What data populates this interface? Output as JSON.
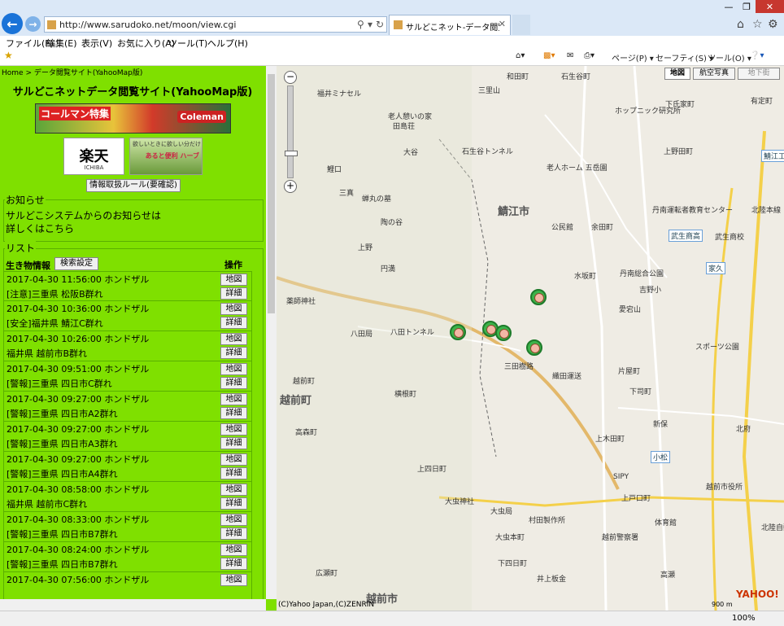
{
  "browser": {
    "url": "http://www.sarudoko.net/moon/view.cgi",
    "tab_title": "サルどこネット-データ閲覧サイ...",
    "menu": [
      "ファイル(F)",
      "編集(E)",
      "表示(V)",
      "お気に入り(A)",
      "ツール(T)",
      "ヘルプ(H)"
    ],
    "commands": [
      "ページ(P) ▾",
      "セーフティ(S) ▾",
      "ツール(O) ▾"
    ],
    "zoom": "100%",
    "colors": {
      "accent": "#1a73d8",
      "panel": "#7fe000"
    }
  },
  "left": {
    "breadcrumb": "Home > データ閲覧サイト(YahooMap版)",
    "title": "サルどこネットデータ閲覧サイト(YahooMap版)",
    "ad_coleman_text": "コールマン特集",
    "ad_coleman_brand": "Coleman",
    "ad_rakuten": "楽天",
    "ad_rakuten_sub": "ICHIBA",
    "ad_herb_text": "欲しいときに欲しい分だけ",
    "ad_herb_title": "あると便利 ハーブ",
    "rules_button": "情報取扱ルール(要確認)",
    "notice_legend": "お知らせ",
    "notice_text": [
      "サルどこシステムからのお知らせは",
      "詳しくはこちら"
    ],
    "list_legend": "リスト",
    "list_header": "生き物情報",
    "search_button": "検索設定",
    "ops_header": "操作",
    "map_button": "地図",
    "detail_button": "詳細",
    "rows": [
      {
        "l1": "2017-04-30 11:56:00 ホンドザル",
        "l2": "[注意]三重県 松阪B群れ"
      },
      {
        "l1": "2017-04-30 10:36:00 ホンドザル",
        "l2": "[安全]福井県 鯖江C群れ"
      },
      {
        "l1": "2017-04-30 10:26:00 ホンドザル",
        "l2": "福井県 越前市B群れ"
      },
      {
        "l1": "2017-04-30 09:51:00 ホンドザル",
        "l2": "[警報]三重県 四日市C群れ"
      },
      {
        "l1": "2017-04-30 09:27:00 ホンドザル",
        "l2": "[警報]三重県 四日市A2群れ"
      },
      {
        "l1": "2017-04-30 09:27:00 ホンドザル",
        "l2": "[警報]三重県 四日市A3群れ"
      },
      {
        "l1": "2017-04-30 09:27:00 ホンドザル",
        "l2": "[警報]三重県 四日市A4群れ"
      },
      {
        "l1": "2017-04-30 08:58:00 ホンドザル",
        "l2": "福井県 越前市C群れ"
      },
      {
        "l1": "2017-04-30 08:33:00 ホンドザル",
        "l2": "[警報]三重県 四日市B7群れ"
      },
      {
        "l1": "2017-04-30 08:24:00 ホンドザル",
        "l2": "[警報]三重県 四日市B7群れ"
      },
      {
        "l1": "2017-04-30 07:56:00 ホンドザル",
        "l2": ""
      }
    ]
  },
  "map": {
    "type_buttons": [
      "地図",
      "航空写真",
      "地下街"
    ],
    "copyright": "(C)Yahoo Japan,(C)ZENRIN",
    "scale": "900 m",
    "logo": "YAHOO!",
    "city_labels": [
      "鯖江市",
      "越前町",
      "越前市"
    ],
    "labels": [
      "福井ミナセル",
      "老人憩いの家",
      "田島荘",
      "大谷",
      "鯉口",
      "石生谷トンネル",
      "三里山",
      "和田町",
      "三真",
      "蝉丸の墓",
      "陶の谷",
      "上野",
      "円満",
      "八田局",
      "八田トンネル",
      "薬師神社",
      "三田樹路",
      "織田運送",
      "横根町",
      "越前町",
      "高森町",
      "上四日町",
      "大虫神社",
      "大虫局",
      "村田製作所",
      "大虫本町",
      "下四日町",
      "井上板金",
      "広瀬町",
      "石生谷町",
      "老人ホーム 五岳園",
      "公民館",
      "余田町",
      "丹南総合公園",
      "吉野小",
      "水坂町",
      "愛宕山",
      "片屋町",
      "下司町",
      "上木田町",
      "新保",
      "小松",
      "越前警察署",
      "越前市役所",
      "体育館",
      "高瀬",
      "北府",
      "家久",
      "武生商高",
      "武生商校",
      "スポーツ公園",
      "北陸本線",
      "北陸自動車道",
      "ホップニック研究所",
      "上野田町",
      "鯖江工",
      "有定町",
      "丹南運転者教育センター",
      "下氏家町",
      "上戸口町",
      "SIPY"
    ]
  }
}
